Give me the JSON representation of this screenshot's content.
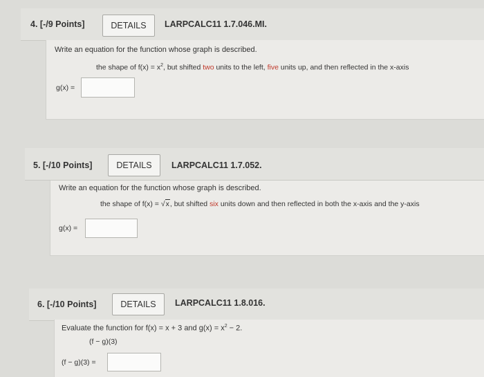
{
  "q4": {
    "number": "4.",
    "points": "[-/9 Points]",
    "details": "DETAILS",
    "code": "LARPCALC11 1.7.046.MI.",
    "prompt": "Write an equation for the function whose graph is described.",
    "desc_pre": "the shape of f(x) = x",
    "desc_exp": "2",
    "desc_mid1": ", but shifted ",
    "desc_hl1": "two",
    "desc_mid2": " units to the left, ",
    "desc_hl2": "five",
    "desc_post": " units up, and then reflected in the x-axis",
    "answer_label": "g(x) =",
    "answer_value": ""
  },
  "q5": {
    "number": "5.",
    "points": "[-/10 Points]",
    "details": "DETAILS",
    "code": "LARPCALC11 1.7.052.",
    "prompt": "Write an equation for the function whose graph is described.",
    "desc_pre": "the shape of f(x) = ",
    "desc_rad": "x",
    "desc_mid1": ", but shifted ",
    "desc_hl1": "six",
    "desc_post": " units down and then reflected in both the x-axis and the y-axis",
    "answer_label": "g(x) =",
    "answer_value": ""
  },
  "q6": {
    "number": "6.",
    "points": "[-/10 Points]",
    "details": "DETAILS",
    "code": "LARPCALC11 1.8.016.",
    "prompt_pre": "Evaluate the function for f(x) = x + 3 and g(x) = x",
    "prompt_exp": "2",
    "prompt_post": " − 2.",
    "expr": "(f − g)(3)",
    "answer_label": "(f − g)(3) =",
    "answer_value": ""
  }
}
